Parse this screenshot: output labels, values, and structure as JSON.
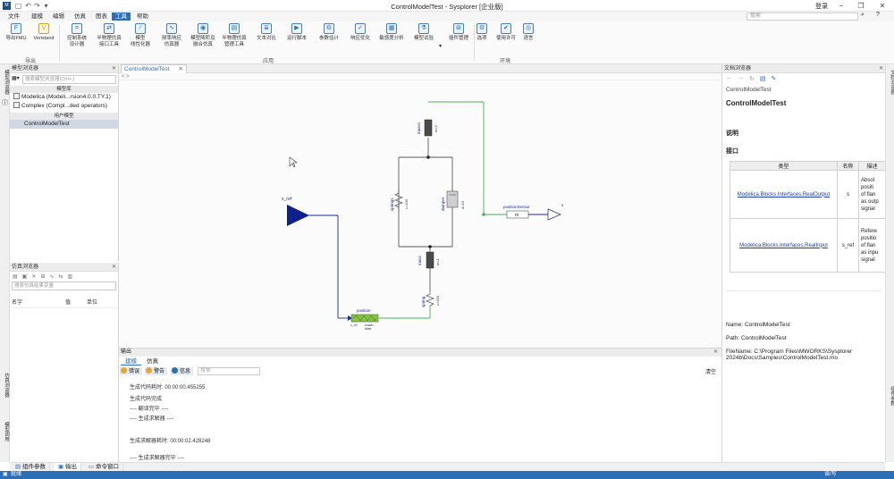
{
  "window": {
    "title": "ControlModelTest - Sysplorer [企业版]",
    "login": "登录"
  },
  "menu": {
    "items": [
      "文件",
      "建模",
      "编辑",
      "仿真",
      "图表",
      "工具",
      "帮助"
    ],
    "active_index": 5,
    "search_placeholder": "搜索"
  },
  "ribbon": {
    "buttons": [
      {
        "label": "导出FMU",
        "icon": "fmu-export-icon"
      },
      {
        "label": "Veristand",
        "icon": "veristand-icon"
      },
      {
        "label": "控制系统\n设计器",
        "icon": "control-designer-icon"
      },
      {
        "label": "半物理仿真\n接口工具",
        "icon": "hil-interface-icon"
      },
      {
        "label": "模型\n线性化器",
        "icon": "linearizer-icon"
      },
      {
        "label": "频率响应\n仿真器",
        "icon": "freq-response-icon"
      },
      {
        "label": "模型降阶及\n融合仿真",
        "icon": "model-reduction-icon"
      },
      {
        "label": "半物理仿真\n管理工具",
        "icon": "hil-manager-icon"
      },
      {
        "label": "文本对比",
        "icon": "text-compare-icon"
      },
      {
        "label": "运行脚本",
        "icon": "run-script-icon"
      },
      {
        "label": "参数估计",
        "icon": "param-estimation-icon"
      },
      {
        "label": "响应优化",
        "icon": "response-optimization-icon"
      },
      {
        "label": "敏感度分析",
        "icon": "sensitivity-icon"
      },
      {
        "label": "模型试验",
        "icon": "model-experiment-icon"
      },
      {
        "label": "插件管理",
        "icon": "plugin-manager-icon"
      },
      {
        "label": "选项",
        "icon": "gear-icon"
      },
      {
        "label": "使用许可",
        "icon": "license-icon"
      },
      {
        "label": "语言",
        "icon": "language-icon"
      }
    ],
    "groups": [
      "导出",
      "应用",
      "环境"
    ]
  },
  "left_strip": {
    "tabs": [
      "模型浏览器",
      "仿真浏览器",
      "模型调用"
    ]
  },
  "model_browser": {
    "title": "模型浏览器",
    "search_placeholder": "搜索模型浏览器(Ctrl+;)",
    "library_header": "模型库",
    "libraries": [
      "Modelica (Modeli...rsion4.0.0.TY.1)",
      "Complex (Compl...ded operators)"
    ],
    "user_header": "用户模型",
    "user_models": [
      "ControlModelTest"
    ]
  },
  "sim_browser": {
    "title": "仿真浏览器",
    "search_placeholder": "搜索仿真结果变量",
    "columns": [
      "名字",
      "值",
      "单位"
    ]
  },
  "editor": {
    "tab_label": "ControlModelTest",
    "breadcrumb": "< >",
    "diagram": {
      "labels": {
        "s_ref": "s_ref",
        "mass1": "mass1",
        "mass1_param": "m=2",
        "spring1": "spring1",
        "spring1_param": "c=100",
        "damper": "damper",
        "damper_param": "d=10",
        "mass": "mass",
        "mass_param": "m=1",
        "spring": "spring",
        "spring_param": "c=200",
        "position": "position",
        "position_sub": "exact=\nfalse",
        "s_ref_small": "s_ref",
        "positionSensor": "positionSensor",
        "sensor_m": "m",
        "s_out": "s"
      }
    }
  },
  "output": {
    "title": "输出",
    "tabs": [
      "建模",
      "仿真"
    ],
    "active_tab": 0,
    "filters": [
      {
        "label": "错误",
        "color": "#e8a33a"
      },
      {
        "label": "警告",
        "color": "#e8a33a"
      },
      {
        "label": "信息",
        "color": "#2c6fb7"
      }
    ],
    "search_placeholder": "搜索",
    "clear": "清空",
    "lines": [
      "生成代码耗时: 00:00:00.455255",
      "生成代码完成",
      "---- 翻译完毕 ----",
      "---- 生成求解器 ----",
      "生成求解器耗时: 00:00:02.428248",
      "---- 生成求解器完毕 ----"
    ]
  },
  "doc_browser": {
    "title": "文档浏览器",
    "breadcrumb": "ControlModelTest",
    "heading": "ControlModelTest",
    "section_desc": "说明",
    "section_iface": "接口",
    "table_headers": [
      "类型",
      "名称",
      "描述"
    ],
    "rows": [
      {
        "type": "Modelica.Blocks.Interfaces.RealOutput",
        "name": "s",
        "desc": "Absol\npositi\nof flan\nas outp\nsignal"
      },
      {
        "type": "Modelica.Blocks.Interfaces.RealInput",
        "name": "s_ref",
        "desc": "Refere\npositio\nof flan\nas inpu\nsignal"
      }
    ],
    "name_line": "Name: ControlModelTest",
    "path_line": "Path: ControlModelTest",
    "file_line": "FileName: C:\\Program Files\\MWORKS\\Sysplorer\n2024b\\Docs\\Samples\\ControlModelTest.mo"
  },
  "right_strip": {
    "tabs": [
      "文档浏览器",
      "组件参数"
    ]
  },
  "bottom_tabs": [
    "组件参数",
    "输出",
    "命令窗口"
  ],
  "bottom_active": 1,
  "status": {
    "left": "就绪",
    "right": "读/写"
  },
  "colors": {
    "accent": "#2c6fb7",
    "signal_blue": "#1a2a9a",
    "wire_green": "#4caf50",
    "mech_gray": "#5a5a5a"
  }
}
